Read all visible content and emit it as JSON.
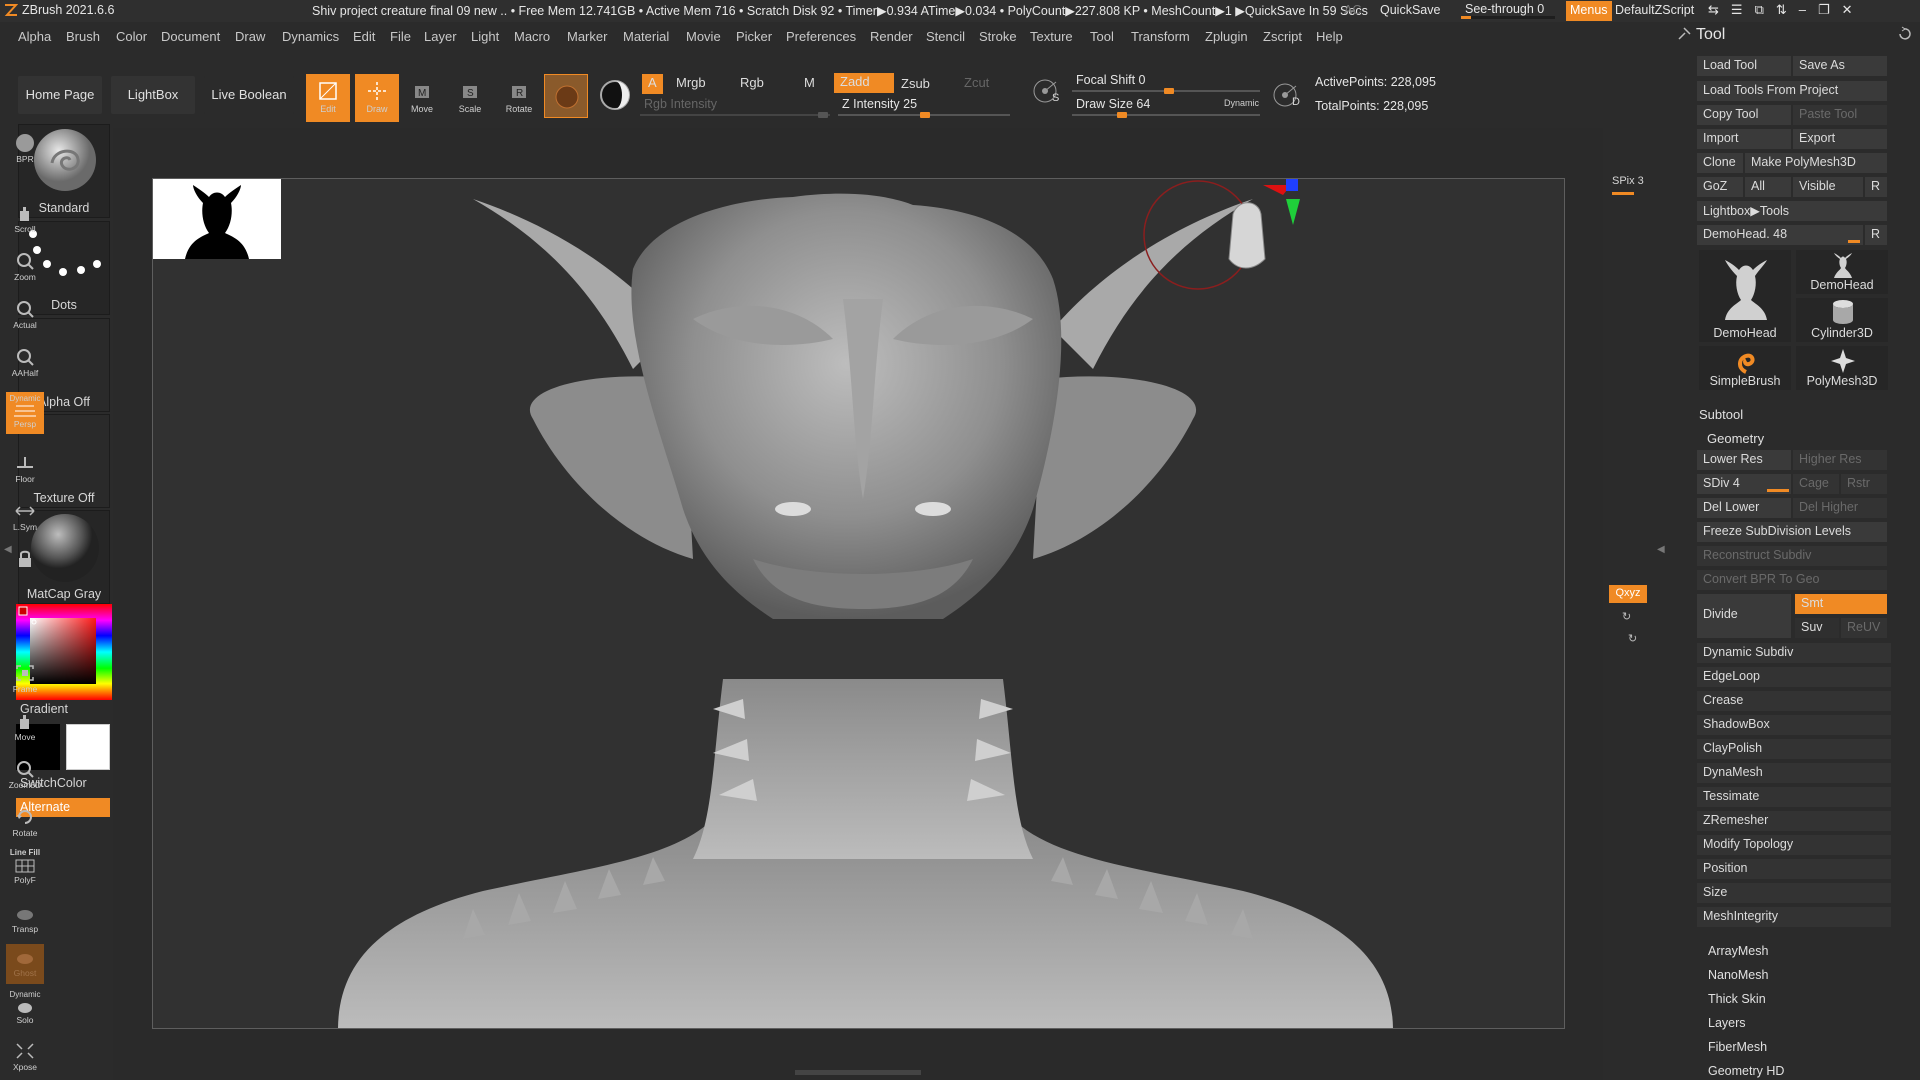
{
  "titlebar": {
    "app_title": "ZBrush 2021.6.6",
    "stats": "Shiv project creature final 09 new  .. • Free Mem 12.741GB • Active Mem 716 • Scratch Disk 92 • Timer▶0.934 ATime▶0.034 • PolyCount▶227.808 KP • MeshCount▶1  ▶QuickSave In 59 Secs",
    "ac": "AC",
    "quicksave": "QuickSave",
    "see_through": "See-through  0",
    "see_through_value": 0,
    "menus": "Menus",
    "default_zscript": "DefaultZScript"
  },
  "menubar": {
    "items": [
      "Alpha",
      "Brush",
      "Color",
      "Document",
      "Draw",
      "Dynamics",
      "Edit",
      "File",
      "Layer",
      "Light",
      "Macro",
      "Marker",
      "Material",
      "Movie",
      "Picker",
      "Preferences",
      "Render",
      "Stencil",
      "Stroke",
      "Texture",
      "Tool",
      "Transform",
      "Zplugin",
      "Zscript",
      "Help"
    ]
  },
  "shelf": {
    "home_page": "Home Page",
    "lightbox": "LightBox",
    "live_boolean": "Live Boolean",
    "edit": "Edit",
    "draw": "Draw",
    "move": "Move",
    "scale": "Scale",
    "rotate": "Rotate",
    "a_toggle": "A",
    "mrgb": "Mrgb",
    "rgb": "Rgb",
    "m": "M",
    "zadd": "Zadd",
    "zsub": "Zsub",
    "zcut": "Zcut",
    "rgb_intensity": "Rgb Intensity",
    "z_intensity": "Z Intensity 25",
    "z_intensity_value": 25,
    "focal_shift": "Focal Shift 0",
    "focal_shift_value": 0,
    "draw_size": "Draw Size 64",
    "draw_size_value": 64,
    "dynamic": "Dynamic",
    "active_points": "ActivePoints: 228,095",
    "total_points": "TotalPoints: 228,095",
    "s_label": "S",
    "d_label": "D"
  },
  "lefttray": {
    "brush": "Standard",
    "stroke": "Dots",
    "alpha": "Alpha Off",
    "texture": "Texture Off",
    "material": "MatCap Gray",
    "gradient": "Gradient",
    "switch_color": "SwitchColor",
    "alternate": "Alternate"
  },
  "rightshelf": {
    "bpr": "BPR",
    "spix": "SPix 3",
    "scroll": "Scroll",
    "zoom": "Zoom",
    "actual": "Actual",
    "aahalf": "AAHalf",
    "dynamic_persp_top": "Dynamic",
    "persp": "Persp",
    "floor": "Floor",
    "lsym": "L.Sym",
    "xyz": "Qxyz",
    "frame": "Frame",
    "move": "Move",
    "zoom3d": "Zoom3D",
    "rotate": "Rotate",
    "linefill": "Line Fill",
    "polyf": "PolyF",
    "transp": "Transp",
    "ghost": "Ghost",
    "dynamic_solo_top": "Dynamic",
    "solo": "Solo",
    "xpose": "Xpose"
  },
  "palette": {
    "title": "Tool",
    "load_tool": "Load Tool",
    "save_as": "Save As",
    "load_tools_from_project": "Load Tools From Project",
    "copy_tool": "Copy Tool",
    "paste_tool": "Paste Tool",
    "import": "Import",
    "export": "Export",
    "clone": "Clone",
    "make_polymesh": "Make PolyMesh3D",
    "goz": "GoZ",
    "all": "All",
    "visible": "Visible",
    "r": "R",
    "lightbox_tools": "Lightbox▶Tools",
    "demohead_slider": "DemoHead. 48",
    "demohead_value": 48,
    "tools": [
      "DemoHead",
      "DemoHead",
      "Cylinder3D",
      "SimpleBrush",
      "PolyMesh3D"
    ],
    "subtool": "Subtool",
    "geometry": "Geometry",
    "lower_res": "Lower Res",
    "higher_res": "Higher Res",
    "sdiv": "SDiv 4",
    "sdiv_value": 4,
    "cage": "Cage",
    "rstr": "Rstr",
    "del_lower": "Del Lower",
    "del_higher": "Del Higher",
    "freeze": "Freeze SubDivision Levels",
    "reconstruct": "Reconstruct Subdiv",
    "convert_bpr": "Convert BPR To Geo",
    "divide": "Divide",
    "smt": "Smt",
    "suv": "Suv",
    "reuv": "ReUV",
    "geometry_items": [
      "Dynamic Subdiv",
      "EdgeLoop",
      "Crease",
      "ShadowBox",
      "ClayPolish",
      "DynaMesh",
      "Tessimate",
      "ZRemesher",
      "Modify Topology",
      "Position",
      "Size",
      "MeshIntegrity"
    ],
    "sub_palettes": [
      "ArrayMesh",
      "NanoMesh",
      "Thick Skin",
      "Layers",
      "FiberMesh",
      "Geometry HD"
    ]
  }
}
